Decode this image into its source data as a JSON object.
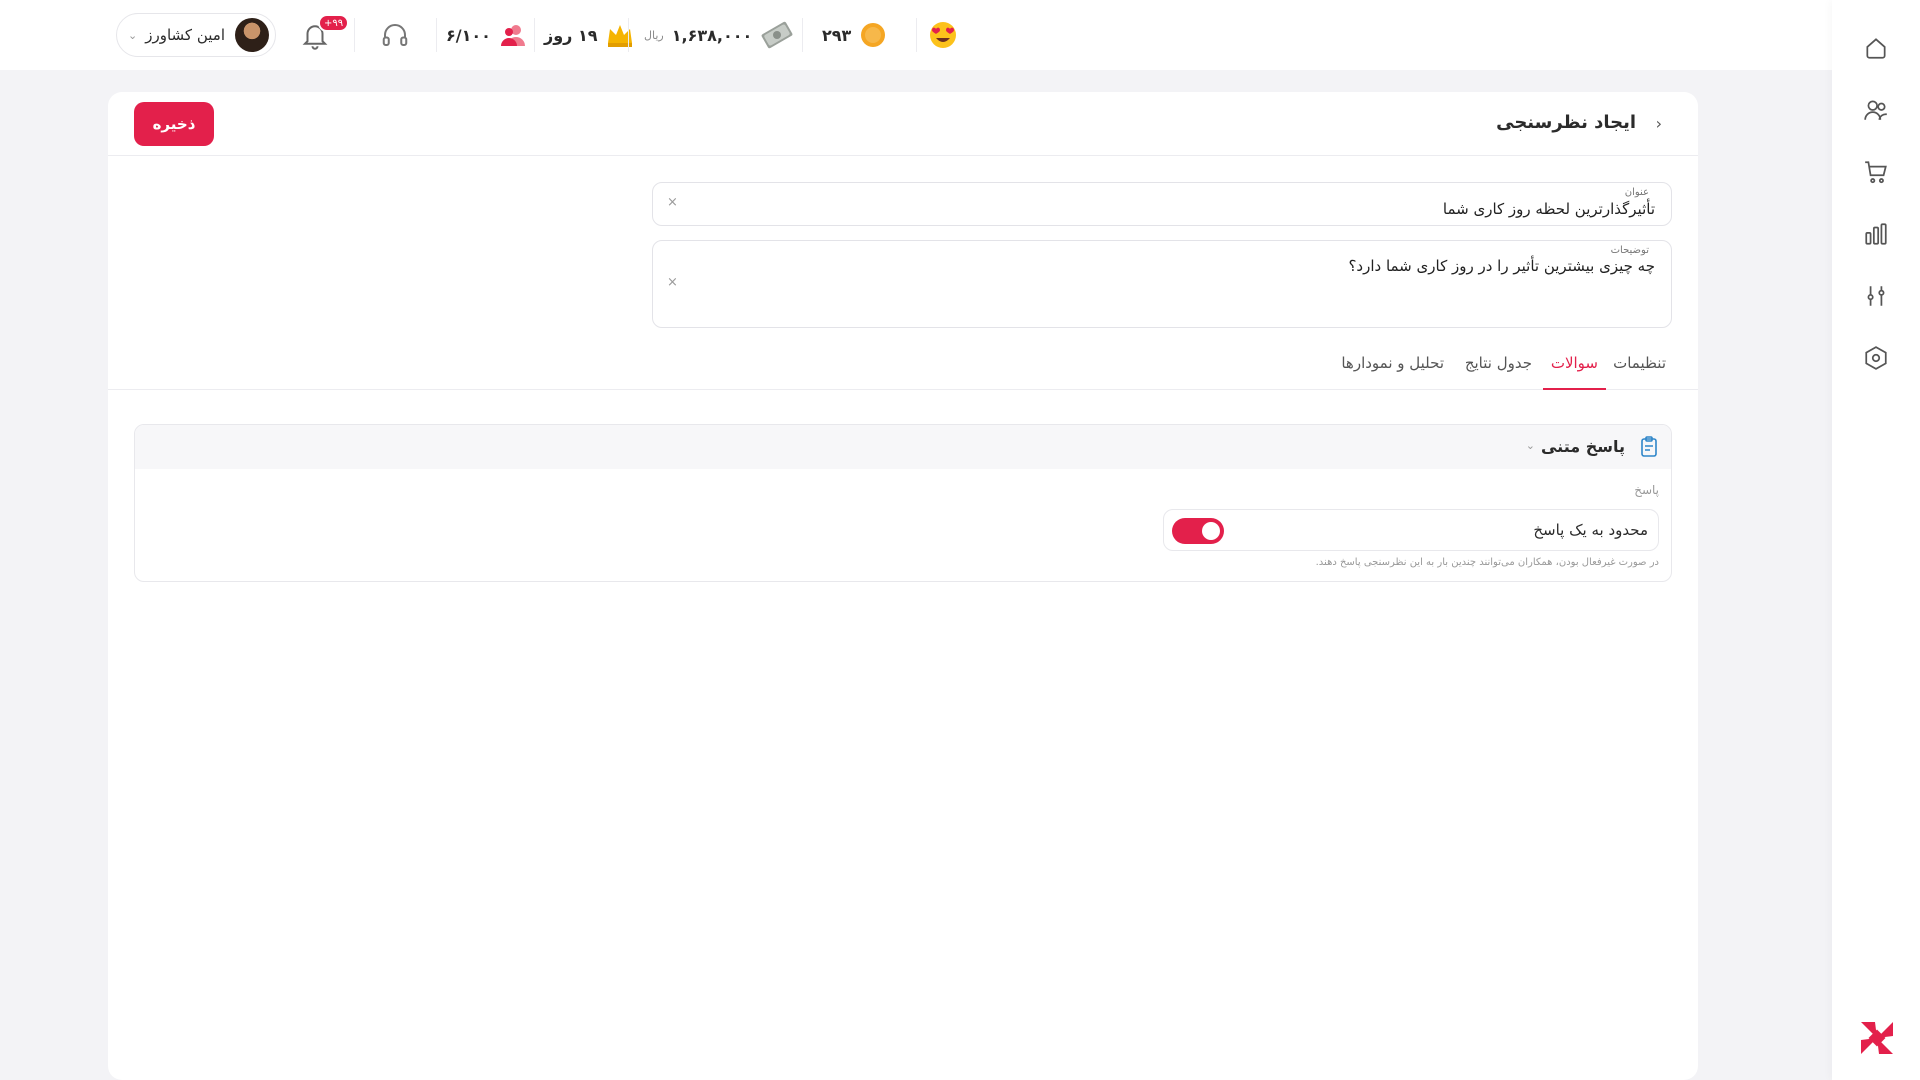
{
  "topbar": {
    "user_name": "امین کشاورز",
    "notifications_badge": "+۹۹",
    "capacity": "۶/۱۰۰",
    "subscription_days": "۱۹ روز",
    "balance": "۱,۶۳۸,۰۰۰",
    "balance_unit": "ریال",
    "coins": "۲۹۳"
  },
  "page": {
    "title": "ایجاد نظرسنجی",
    "save_label": "ذخیره"
  },
  "form": {
    "title_label": "عنوان",
    "title_value": "تأثیرگذارترین لحظه روز کاری شما",
    "description_label": "توضیحات",
    "description_value": "چه چیزی بیشترین تأثیر را در روز کاری شما دارد؟",
    "clear_symbol": "×"
  },
  "tabs": [
    {
      "label": "تنظیمات",
      "active": false
    },
    {
      "label": "سوالات",
      "active": true
    },
    {
      "label": "جدول نتایج",
      "active": false
    },
    {
      "label": "تحلیل و نمودارها",
      "active": false
    }
  ],
  "question": {
    "type_title": "پاسخ متنی",
    "answer_label": "پاسخ",
    "limit_label": "محدود به یک پاسخ",
    "limit_enabled": true,
    "limit_hint": "در صورت غیرفعال بودن، همکاران می‌توانند چندین بار به این نظرسنجی پاسخ دهند."
  },
  "sidebar": {
    "items": [
      "home-icon",
      "users-icon",
      "cart-icon",
      "chart-icon",
      "settings-sliders-icon",
      "hexagon-settings-icon"
    ]
  },
  "colors": {
    "accent": "#e3204b",
    "background": "#f3f3f6"
  }
}
